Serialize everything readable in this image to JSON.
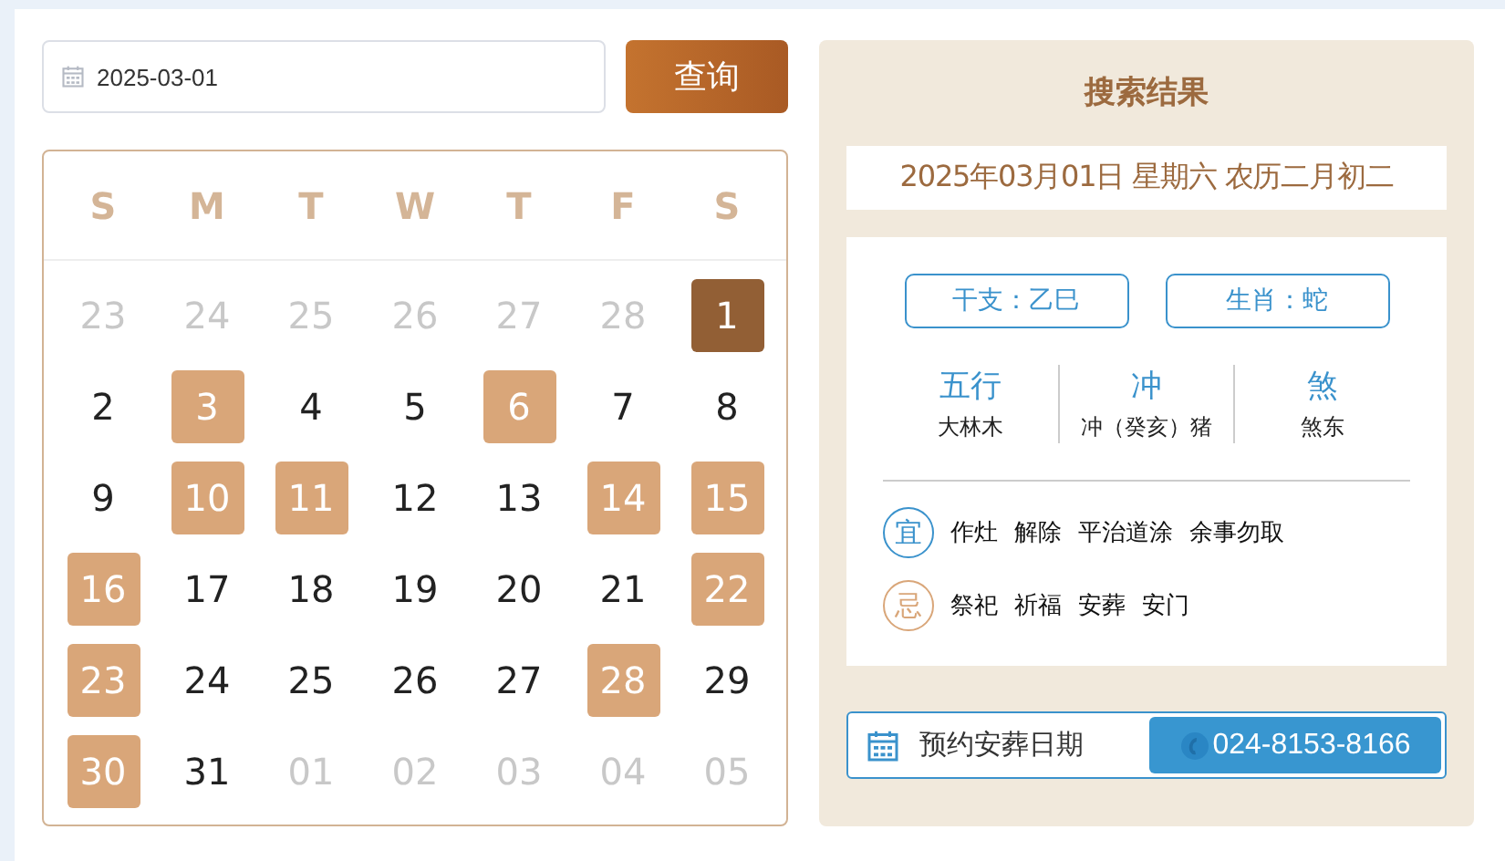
{
  "search": {
    "value": "2025-03-01",
    "button": "查询"
  },
  "calendar": {
    "weekdays": [
      "S",
      "M",
      "T",
      "W",
      "T",
      "F",
      "S"
    ],
    "days": [
      {
        "label": "23",
        "outside": true,
        "marked": false,
        "selected": false
      },
      {
        "label": "24",
        "outside": true,
        "marked": false,
        "selected": false
      },
      {
        "label": "25",
        "outside": true,
        "marked": false,
        "selected": false
      },
      {
        "label": "26",
        "outside": true,
        "marked": false,
        "selected": false
      },
      {
        "label": "27",
        "outside": true,
        "marked": false,
        "selected": false
      },
      {
        "label": "28",
        "outside": true,
        "marked": false,
        "selected": false
      },
      {
        "label": "1",
        "outside": false,
        "marked": false,
        "selected": true
      },
      {
        "label": "2",
        "outside": false,
        "marked": false,
        "selected": false
      },
      {
        "label": "3",
        "outside": false,
        "marked": true,
        "selected": false
      },
      {
        "label": "4",
        "outside": false,
        "marked": false,
        "selected": false
      },
      {
        "label": "5",
        "outside": false,
        "marked": false,
        "selected": false
      },
      {
        "label": "6",
        "outside": false,
        "marked": true,
        "selected": false
      },
      {
        "label": "7",
        "outside": false,
        "marked": false,
        "selected": false
      },
      {
        "label": "8",
        "outside": false,
        "marked": false,
        "selected": false
      },
      {
        "label": "9",
        "outside": false,
        "marked": false,
        "selected": false
      },
      {
        "label": "10",
        "outside": false,
        "marked": true,
        "selected": false
      },
      {
        "label": "11",
        "outside": false,
        "marked": true,
        "selected": false
      },
      {
        "label": "12",
        "outside": false,
        "marked": false,
        "selected": false
      },
      {
        "label": "13",
        "outside": false,
        "marked": false,
        "selected": false
      },
      {
        "label": "14",
        "outside": false,
        "marked": true,
        "selected": false
      },
      {
        "label": "15",
        "outside": false,
        "marked": true,
        "selected": false
      },
      {
        "label": "16",
        "outside": false,
        "marked": true,
        "selected": false
      },
      {
        "label": "17",
        "outside": false,
        "marked": false,
        "selected": false
      },
      {
        "label": "18",
        "outside": false,
        "marked": false,
        "selected": false
      },
      {
        "label": "19",
        "outside": false,
        "marked": false,
        "selected": false
      },
      {
        "label": "20",
        "outside": false,
        "marked": false,
        "selected": false
      },
      {
        "label": "21",
        "outside": false,
        "marked": false,
        "selected": false
      },
      {
        "label": "22",
        "outside": false,
        "marked": true,
        "selected": false
      },
      {
        "label": "23",
        "outside": false,
        "marked": true,
        "selected": false
      },
      {
        "label": "24",
        "outside": false,
        "marked": false,
        "selected": false
      },
      {
        "label": "25",
        "outside": false,
        "marked": false,
        "selected": false
      },
      {
        "label": "26",
        "outside": false,
        "marked": false,
        "selected": false
      },
      {
        "label": "27",
        "outside": false,
        "marked": false,
        "selected": false
      },
      {
        "label": "28",
        "outside": false,
        "marked": true,
        "selected": false
      },
      {
        "label": "29",
        "outside": false,
        "marked": false,
        "selected": false
      },
      {
        "label": "30",
        "outside": false,
        "marked": true,
        "selected": false
      },
      {
        "label": "31",
        "outside": false,
        "marked": false,
        "selected": false
      },
      {
        "label": "01",
        "outside": true,
        "marked": false,
        "selected": false
      },
      {
        "label": "02",
        "outside": true,
        "marked": false,
        "selected": false
      },
      {
        "label": "03",
        "outside": true,
        "marked": false,
        "selected": false
      },
      {
        "label": "04",
        "outside": true,
        "marked": false,
        "selected": false
      },
      {
        "label": "05",
        "outside": true,
        "marked": false,
        "selected": false
      }
    ]
  },
  "result": {
    "title": "搜索结果",
    "date": "2025年03月01日 星期六 农历二月初二",
    "tags": [
      "干支：乙巳",
      "生肖：蛇"
    ],
    "facts": [
      {
        "heading": "五行",
        "value": "大林木"
      },
      {
        "heading": "冲",
        "value": "冲（癸亥）猪"
      },
      {
        "heading": "煞",
        "value": "煞东"
      }
    ],
    "advice": [
      {
        "kind": "good",
        "badge": "宜",
        "items": [
          "作灶",
          "解除",
          "平治道涂",
          "余事勿取"
        ]
      },
      {
        "kind": "bad",
        "badge": "忌",
        "items": [
          "祭祀",
          "祈福",
          "安葬",
          "安门"
        ]
      }
    ],
    "booking": {
      "label": "预约安葬日期",
      "phone": "024-8153-8166"
    }
  }
}
